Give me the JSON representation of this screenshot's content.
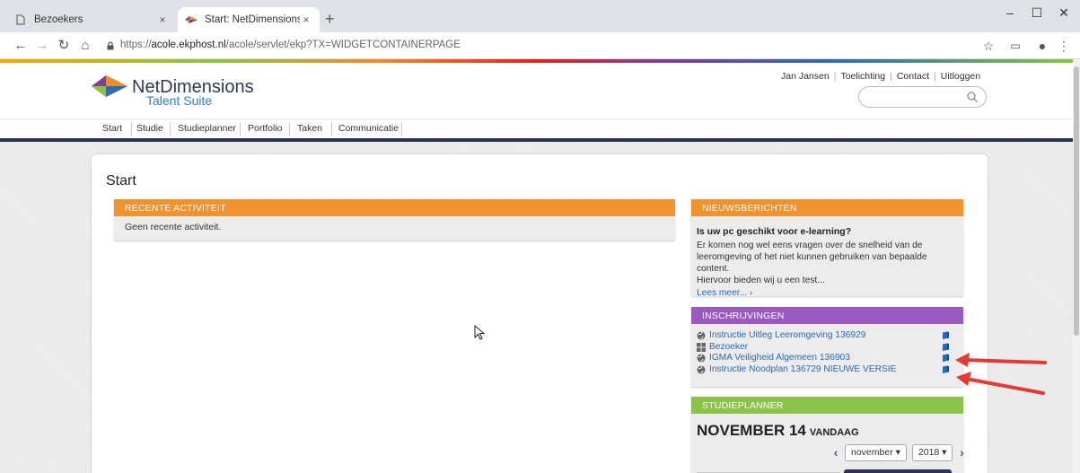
{
  "browser": {
    "tabs": [
      {
        "title": "Bezoekers",
        "active": false
      },
      {
        "title": "Start: NetDimensions Talent Suite",
        "active": true
      }
    ],
    "close_symbol": "×",
    "newtab_symbol": "+",
    "url_prefix": "https://",
    "url_host": "acole.ekphost.nl",
    "url_path": "/acole/servlet/ekp?TX=WIDGETCONTAINERPAGE",
    "window_controls": {
      "minimize": "–",
      "maximize": "☐",
      "close": "✕"
    }
  },
  "brand": {
    "name": "NetDimensions",
    "sub": "Talent Suite"
  },
  "top_links": [
    "Jan Jansen",
    "Toelichting",
    "Contact",
    "Uitloggen"
  ],
  "nav": [
    "Start",
    "Studie",
    "Studieplanner",
    "Portfolio",
    "Taken",
    "Communicatie"
  ],
  "page": {
    "title": "Start"
  },
  "recent": {
    "heading": "RECENTE ACTIVITEIT",
    "text": "Geen recente activiteit."
  },
  "news": {
    "heading": "NIEUWSBERICHTEN",
    "item_title": "Is uw pc geschikt voor e-learning?",
    "item_lines": [
      "Er komen nog wel eens vragen over de snelheid van de",
      "leeromgeving of het niet kunnen gebruiken van bepaalde content.",
      "Hiervoor bieden wij u een test..."
    ],
    "read_more": "Lees meer... ›"
  },
  "enrollments": {
    "heading": "INSCHRIJVINGEN",
    "items": [
      {
        "label": "Instructie Uitleg Leeromgeving 136929",
        "icon": "globe-icon"
      },
      {
        "label": "Bezoeker",
        "icon": "grid-icon"
      },
      {
        "label": "IGMA Veiligheid Algemeen 136903",
        "icon": "globe-icon"
      },
      {
        "label": "Instructie Noodplan 136729 NIEUWE VERSIE",
        "icon": "globe-icon"
      }
    ]
  },
  "planner": {
    "heading": "STUDIEPLANNER",
    "date": "NOVEMBER 14",
    "today": "VANDAAG",
    "month": "november ▾",
    "year": "2018 ▾"
  },
  "colors": {
    "orange": "#f0922e",
    "purple": "#9b59c2",
    "green": "#8bc34a",
    "navy": "#2a3350",
    "link": "#2a6ab3",
    "annotation_arrow": "#e53935"
  }
}
